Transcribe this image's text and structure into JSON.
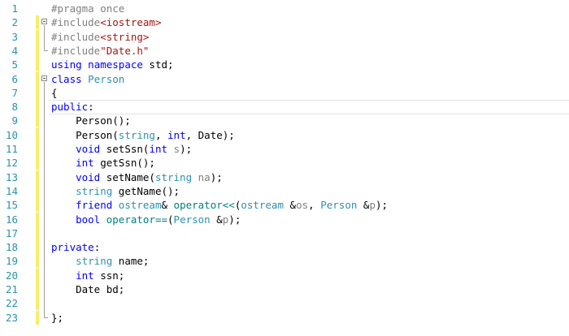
{
  "colors": {
    "line_number": "#2b91af",
    "keyword": "#0000ff",
    "type": "#2b91af",
    "preprocessor": "#808080",
    "string": "#a31515",
    "operator": "#008080",
    "parameter": "#808080",
    "changed_marker": "#f6ee6b",
    "saved_marker": "#ffffff"
  },
  "editor": {
    "lines": [
      {
        "number": "1",
        "changed": false,
        "tokens": [
          {
            "t": "#pragma once",
            "c": "pp"
          }
        ]
      },
      {
        "number": "2",
        "changed": true,
        "tokens": [
          {
            "t": "#include",
            "c": "pp"
          },
          {
            "t": "<iostream>",
            "c": "st"
          }
        ]
      },
      {
        "number": "3",
        "changed": true,
        "tokens": [
          {
            "t": "#include",
            "c": "pp"
          },
          {
            "t": "<string>",
            "c": "st"
          }
        ]
      },
      {
        "number": "4",
        "changed": true,
        "tokens": [
          {
            "t": "#include",
            "c": "pp"
          },
          {
            "t": "\"Date.h\"",
            "c": "st"
          }
        ]
      },
      {
        "number": "5",
        "changed": true,
        "tokens": [
          {
            "t": "using",
            "c": "kw"
          },
          {
            "t": " ",
            "c": "tx"
          },
          {
            "t": "namespace",
            "c": "kw"
          },
          {
            "t": " std;",
            "c": "tx"
          }
        ]
      },
      {
        "number": "6",
        "changed": true,
        "tokens": [
          {
            "t": "class",
            "c": "kw"
          },
          {
            "t": " ",
            "c": "tx"
          },
          {
            "t": "Person",
            "c": "ty"
          }
        ]
      },
      {
        "number": "7",
        "changed": true,
        "tokens": [
          {
            "t": "{",
            "c": "tx"
          }
        ]
      },
      {
        "number": "8",
        "changed": true,
        "tokens": [
          {
            "t": "public",
            "c": "kw"
          },
          {
            "t": ":",
            "c": "tx"
          }
        ]
      },
      {
        "number": "9",
        "changed": true,
        "tokens": [
          {
            "t": "    Person();",
            "c": "tx"
          }
        ]
      },
      {
        "number": "10",
        "changed": true,
        "tokens": [
          {
            "t": "    Person(",
            "c": "tx"
          },
          {
            "t": "string",
            "c": "ty"
          },
          {
            "t": ", ",
            "c": "tx"
          },
          {
            "t": "int",
            "c": "kw"
          },
          {
            "t": ", Date);",
            "c": "tx"
          }
        ]
      },
      {
        "number": "11",
        "changed": true,
        "tokens": [
          {
            "t": "    ",
            "c": "tx"
          },
          {
            "t": "void",
            "c": "kw"
          },
          {
            "t": " setSsn(",
            "c": "tx"
          },
          {
            "t": "int",
            "c": "kw"
          },
          {
            "t": " ",
            "c": "tx"
          },
          {
            "t": "s",
            "c": "pm"
          },
          {
            "t": ");",
            "c": "tx"
          }
        ]
      },
      {
        "number": "12",
        "changed": true,
        "tokens": [
          {
            "t": "    ",
            "c": "tx"
          },
          {
            "t": "int",
            "c": "kw"
          },
          {
            "t": " getSsn();",
            "c": "tx"
          }
        ]
      },
      {
        "number": "13",
        "changed": true,
        "tokens": [
          {
            "t": "    ",
            "c": "tx"
          },
          {
            "t": "void",
            "c": "kw"
          },
          {
            "t": " setName(",
            "c": "tx"
          },
          {
            "t": "string",
            "c": "ty"
          },
          {
            "t": " ",
            "c": "tx"
          },
          {
            "t": "na",
            "c": "pm"
          },
          {
            "t": ");",
            "c": "tx"
          }
        ]
      },
      {
        "number": "14",
        "changed": true,
        "tokens": [
          {
            "t": "    ",
            "c": "tx"
          },
          {
            "t": "string",
            "c": "ty"
          },
          {
            "t": " getName();",
            "c": "tx"
          }
        ]
      },
      {
        "number": "15",
        "changed": true,
        "tokens": [
          {
            "t": "    ",
            "c": "tx"
          },
          {
            "t": "friend",
            "c": "kw"
          },
          {
            "t": " ",
            "c": "tx"
          },
          {
            "t": "ostream",
            "c": "ty"
          },
          {
            "t": "& ",
            "c": "tx"
          },
          {
            "t": "operator<<",
            "c": "op"
          },
          {
            "t": "(",
            "c": "tx"
          },
          {
            "t": "ostream",
            "c": "ty"
          },
          {
            "t": " &",
            "c": "tx"
          },
          {
            "t": "os",
            "c": "pm"
          },
          {
            "t": ", ",
            "c": "tx"
          },
          {
            "t": "Person",
            "c": "ty"
          },
          {
            "t": " &",
            "c": "tx"
          },
          {
            "t": "p",
            "c": "pm"
          },
          {
            "t": ");",
            "c": "tx"
          }
        ]
      },
      {
        "number": "16",
        "changed": true,
        "tokens": [
          {
            "t": "    ",
            "c": "tx"
          },
          {
            "t": "bool",
            "c": "kw"
          },
          {
            "t": " ",
            "c": "tx"
          },
          {
            "t": "operator==",
            "c": "op"
          },
          {
            "t": "(",
            "c": "tx"
          },
          {
            "t": "Person",
            "c": "ty"
          },
          {
            "t": " &",
            "c": "tx"
          },
          {
            "t": "p",
            "c": "pm"
          },
          {
            "t": ");",
            "c": "tx"
          }
        ]
      },
      {
        "number": "17",
        "changed": true,
        "tokens": []
      },
      {
        "number": "18",
        "changed": true,
        "tokens": [
          {
            "t": "private",
            "c": "kw"
          },
          {
            "t": ":",
            "c": "tx"
          }
        ]
      },
      {
        "number": "19",
        "changed": true,
        "tokens": [
          {
            "t": "    ",
            "c": "tx"
          },
          {
            "t": "string",
            "c": "ty"
          },
          {
            "t": " name;",
            "c": "tx"
          }
        ]
      },
      {
        "number": "20",
        "changed": true,
        "tokens": [
          {
            "t": "    ",
            "c": "tx"
          },
          {
            "t": "int",
            "c": "kw"
          },
          {
            "t": " ssn;",
            "c": "tx"
          }
        ]
      },
      {
        "number": "21",
        "changed": true,
        "tokens": [
          {
            "t": "    Date bd;",
            "c": "tx"
          }
        ]
      },
      {
        "number": "22",
        "changed": true,
        "tokens": []
      },
      {
        "number": "23",
        "changed": true,
        "tokens": [
          {
            "t": "};",
            "c": "tx"
          }
        ]
      }
    ]
  }
}
